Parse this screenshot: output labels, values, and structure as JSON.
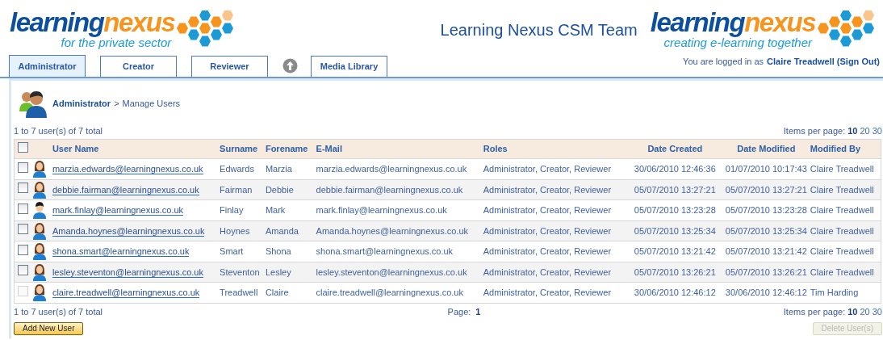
{
  "header": {
    "logo_left": {
      "word1": "learning",
      "word2": "nexus",
      "tagline": "for the private sector"
    },
    "title": "Learning Nexus CSM Team",
    "logo_right": {
      "word1": "learning",
      "word2": "nexus",
      "tagline": "creating e-learning together"
    },
    "login_prefix": "You are logged in as",
    "login_user": "Claire Treadwell (Sign Out)"
  },
  "tabs": [
    {
      "label": "Administrator",
      "selected": true,
      "kind": "tab"
    },
    {
      "label": "Creator",
      "selected": false,
      "kind": "tab"
    },
    {
      "label": "Reviewer",
      "selected": false,
      "kind": "tab"
    },
    {
      "kind": "up"
    },
    {
      "label": "Media Library",
      "selected": false,
      "kind": "tab"
    }
  ],
  "breadcrumb": {
    "section": "Administrator",
    "separator": ">",
    "page": "Manage Users"
  },
  "summary_top": "1 to 7 user(s) of 7 total",
  "items_per_page_top": {
    "label": "Items per page:",
    "options": [
      {
        "label": "10",
        "selected": true
      },
      {
        "label": "20",
        "selected": false
      },
      {
        "label": "30",
        "selected": false
      }
    ]
  },
  "table": {
    "select_all_checked": false,
    "columns": [
      "User Name",
      "Surname",
      "Forename",
      "E-Mail",
      "Roles",
      "Date Created",
      "Date Modified",
      "Modified By"
    ],
    "rows": [
      {
        "kind": "female",
        "checked": false,
        "disabled": false,
        "cells": [
          "marzia.edwards@learningnexus.co.uk",
          "Edwards",
          "Marzia",
          "marzia.edwards@learningnexus.co.uk",
          "Administrator, Creator, Reviewer",
          "30/06/2010 12:46:36",
          "01/07/2010 10:17:43",
          "Claire Treadwell"
        ]
      },
      {
        "kind": "female",
        "checked": false,
        "disabled": false,
        "cells": [
          "debbie.fairman@learningnexus.co.uk",
          "Fairman",
          "Debbie",
          "debbie.fairman@learningnexus.co.uk",
          "Administrator, Creator, Reviewer",
          "05/07/2010 13:27:21",
          "05/07/2010 13:27:21",
          "Claire Treadwell"
        ]
      },
      {
        "kind": "male",
        "checked": false,
        "disabled": false,
        "cells": [
          "mark.finlay@learningnexus.co.uk",
          "Finlay",
          "Mark",
          "mark.finlay@learningnexus.co.uk",
          "Administrator, Creator, Reviewer",
          "05/07/2010 13:23:28",
          "05/07/2010 13:23:28",
          "Claire Treadwell"
        ]
      },
      {
        "kind": "female",
        "checked": false,
        "disabled": false,
        "cells": [
          "Amanda.hoynes@learningnexus.co.uk",
          "Hoynes",
          "Amanda",
          "Amanda.hoynes@learningnexus.co.uk",
          "Administrator, Creator, Reviewer",
          "05/07/2010 13:25:34",
          "05/07/2010 13:25:34",
          "Claire Treadwell"
        ]
      },
      {
        "kind": "female",
        "checked": false,
        "disabled": false,
        "cells": [
          "shona.smart@learningnexus.co.uk",
          "Smart",
          "Shona",
          "shona.smart@learningnexus.co.uk",
          "Administrator, Creator, Reviewer",
          "05/07/2010 13:21:42",
          "05/07/2010 13:21:42",
          "Claire Treadwell"
        ]
      },
      {
        "kind": "female",
        "checked": false,
        "disabled": false,
        "cells": [
          "lesley.steventon@learningnexus.co.uk",
          "Steventon",
          "Lesley",
          "lesley.steventon@learningnexus.co.uk",
          "Administrator, Creator, Reviewer",
          "05/07/2010 13:26:21",
          "05/07/2010 13:26:21",
          "Claire Treadwell"
        ]
      },
      {
        "kind": "female",
        "checked": false,
        "disabled": true,
        "cells": [
          "claire.treadwell@learningnexus.co.uk",
          "Treadwell",
          "Claire",
          "claire.treadwell@learningnexus.co.uk",
          "Administrator, Creator, Reviewer",
          "30/06/2010 12:46:12",
          "30/06/2010 12:46:12",
          "Tim Harding"
        ]
      }
    ]
  },
  "summary_bottom": "1 to 7 user(s) of 7 total",
  "pager": {
    "label": "Page:",
    "current": "1"
  },
  "items_per_page_bottom": {
    "label": "Items per page:",
    "options": [
      {
        "label": "10",
        "selected": true
      },
      {
        "label": "20",
        "selected": false
      },
      {
        "label": "30",
        "selected": false
      }
    ]
  },
  "buttons": [
    {
      "label": "Add New User",
      "disabled": false
    },
    {
      "label": "Delete User(s)",
      "disabled": true
    }
  ]
}
